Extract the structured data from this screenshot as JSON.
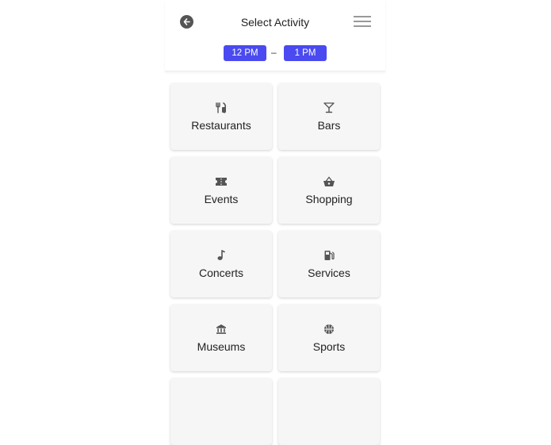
{
  "header": {
    "title": "Select Activity",
    "back_icon": "back-arrow-icon",
    "menu_icon": "hamburger-menu-icon"
  },
  "time_range": {
    "start": "12 PM",
    "separator": "–",
    "end": "1 PM",
    "accent_color": "#4a4af0"
  },
  "activities": [
    {
      "label": "Restaurants",
      "icon": "utensils-icon"
    },
    {
      "label": "Bars",
      "icon": "cocktail-icon"
    },
    {
      "label": "Events",
      "icon": "ticket-icon"
    },
    {
      "label": "Shopping",
      "icon": "basket-icon"
    },
    {
      "label": "Concerts",
      "icon": "music-note-icon"
    },
    {
      "label": "Services",
      "icon": "gas-pump-icon"
    },
    {
      "label": "Museums",
      "icon": "museum-icon"
    },
    {
      "label": "Sports",
      "icon": "basketball-icon"
    }
  ]
}
